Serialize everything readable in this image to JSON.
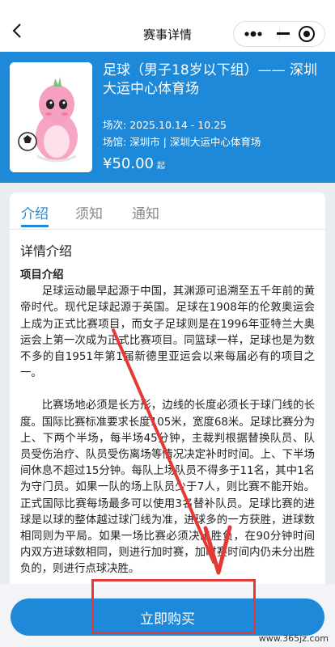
{
  "nav": {
    "title": "赛事详情"
  },
  "event": {
    "title": "足球（男子18岁以下组）—— 深圳大运中心体育场",
    "date_label": "场次:",
    "date_value": "2025.10.14 - 10.25",
    "venue_label": "场馆:",
    "venue_value": "深圳市 | 深圳大运中心体育场",
    "price": "¥50.00",
    "price_suffix": "起"
  },
  "tabs": [
    {
      "label": "介绍",
      "active": true
    },
    {
      "label": "须知",
      "active": false
    },
    {
      "label": "通知",
      "active": false
    }
  ],
  "detail": {
    "section_title": "详情介绍",
    "heading": "项目介绍",
    "paragraph1": "足球运动最早起源于中国，其渊源可追溯至五千年前的黄帝时代。现代足球起源于英国。足球在1908年的伦敦奥运会上成为正式比赛项目，而女子足球则是在1996年亚特兰大奥运会上第一次成为正式比赛项目。同篮球一样，足球也是为数不多的自1951年第1届新德里亚运会以来每届必有的项目之一。",
    "paragraph2": "比赛场地必须是长方形，边线的长度必须长于球门线的长度。国际比赛标准要求长度105米，宽度68米。足球比赛分为上、下两个半场，每半场45分钟，主裁判根据替换队员、队员受伤治疗、队员受伤离场等情况决定补时时间。上、下半场间休息不超过15分钟。每队上场队员不得多于11名，其中1名为守门员。如果一队的场上队员少于7人，则比赛不能开始。正式国际比赛每场最多可以使用3名替补队员。足球比赛的进球是以球的整体越过球门线为准，进球多的一方获胜，进球数相同则为平局。如果一场比赛必须决出胜负，在90分钟时间内双方进球数相同，则进行加时赛，加时赛时间内仍未分出胜负的，则进行点球决胜。"
  },
  "footer": {
    "buy_label": "立即购买"
  },
  "watermark": "www.365jz.com",
  "colors": {
    "primary": "#1d89d8",
    "annotation": "#e53935"
  }
}
